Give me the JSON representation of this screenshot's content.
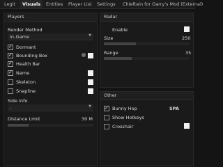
{
  "tabs": [
    "Legit",
    "Visuals",
    "Entities",
    "Player List",
    "Settings",
    "Chieftain for Garry's Mod (External)"
  ],
  "active_tab": "Visuals",
  "players": {
    "title": "Players",
    "render_method_label": "Render Method",
    "render_method_value": "In-Game",
    "items": [
      {
        "label": "Dormant",
        "checked": true
      },
      {
        "label": "Bounding Box",
        "checked": true
      },
      {
        "label": "Health Bar",
        "checked": true
      },
      {
        "label": "Name",
        "checked": true
      },
      {
        "label": "Skeleton",
        "checked": false
      },
      {
        "label": "Snapline",
        "checked": false
      }
    ],
    "side_info_label": "Side Info",
    "side_info_value": "-",
    "distance_label": "Distance Limit",
    "distance_value": "30 M"
  },
  "radar": {
    "title": "Radar",
    "enable_label": "Enable",
    "size_label": "Size",
    "size_value": "250",
    "range_label": "Range",
    "range_value": "35"
  },
  "other": {
    "title": "Other",
    "bunny_hop_label": "Bunny Hop",
    "bunny_hop_mode": "SPA",
    "show_hotkeys_label": "Show Hotkeys",
    "crosshair_label": "Crosshair"
  }
}
